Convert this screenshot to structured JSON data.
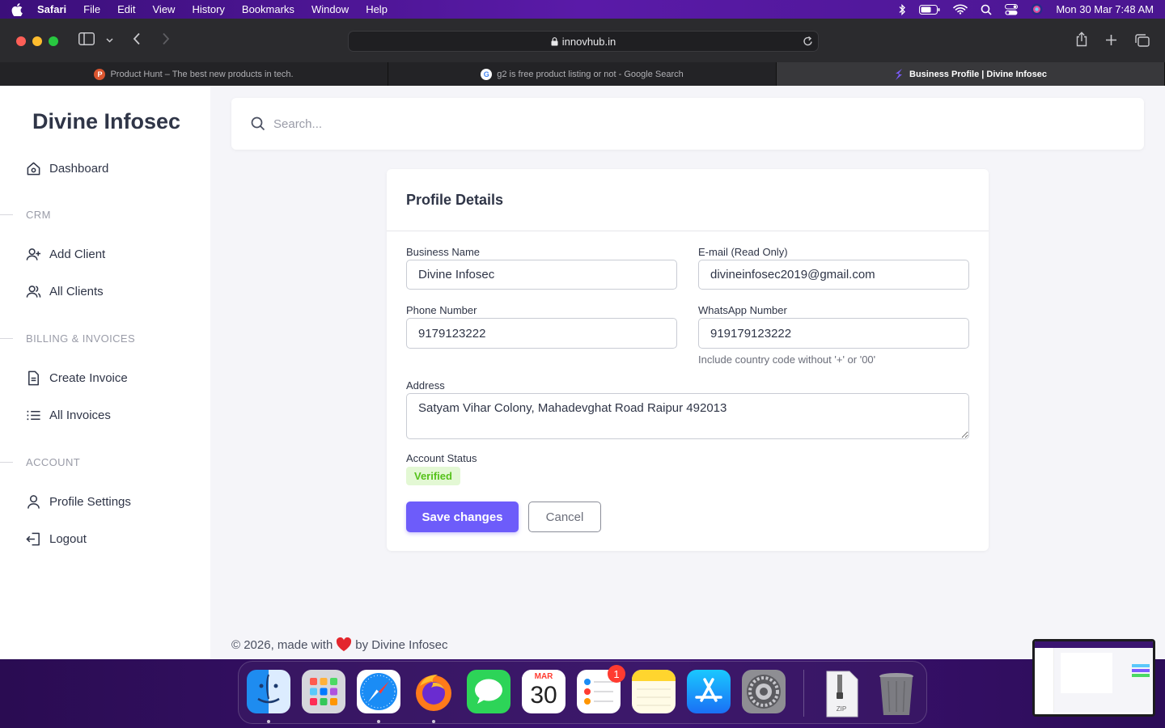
{
  "menubar": {
    "app": "Safari",
    "items": [
      "File",
      "Edit",
      "View",
      "History",
      "Bookmarks",
      "Window",
      "Help"
    ],
    "clock": "Mon 30 Mar  7:48 AM"
  },
  "browser": {
    "url": "innovhub.in",
    "tabs": [
      {
        "title": "Product Hunt – The best new products in tech.",
        "favicon": "product-hunt-icon",
        "color": "#da552f",
        "letter": "P"
      },
      {
        "title": "g2 is free product listing or not - Google Search",
        "favicon": "google-icon",
        "color": "#ffffff",
        "letter": "G"
      },
      {
        "title": "Business Profile | Divine Infosec",
        "favicon": "divine-infosec-icon",
        "color": "#7b5cff",
        "letter": ""
      }
    ]
  },
  "sidebar": {
    "brand": "Divine Infosec",
    "dashboard": "Dashboard",
    "sections": {
      "crm": "CRM",
      "billing": "BILLING & INVOICES",
      "account": "ACCOUNT"
    },
    "items": {
      "add_client": "Add Client",
      "all_clients": "All Clients",
      "create_invoice": "Create Invoice",
      "all_invoices": "All Invoices",
      "profile_settings": "Profile Settings",
      "logout": "Logout"
    }
  },
  "search": {
    "placeholder": "Search..."
  },
  "profile": {
    "title": "Profile Details",
    "business_name_label": "Business Name",
    "business_name": "Divine Infosec",
    "email_label": "E-mail (Read Only)",
    "email": "divineinfosec2019@gmail.com",
    "phone_label": "Phone Number",
    "phone": "9179123222",
    "whatsapp_label": "WhatsApp Number",
    "whatsapp": "919179123222",
    "whatsapp_hint": "Include country code without '+' or '00'",
    "address_label": "Address",
    "address": "Satyam Vihar Colony, Mahadevghat Road Raipur 492013",
    "status_label": "Account Status",
    "status": "Verified",
    "save": "Save changes",
    "cancel": "Cancel"
  },
  "footer": {
    "prefix": "© 2026, made with",
    "suffix": "by Divine Infosec"
  },
  "dock": {
    "calendar_month": "MAR",
    "calendar_day": "30",
    "reminders_badge": "1",
    "zip_label": "ZIP"
  },
  "colors": {
    "accent": "#6d5cfa",
    "verified_bg": "#e3f8d4",
    "verified_text": "#56c21b"
  }
}
